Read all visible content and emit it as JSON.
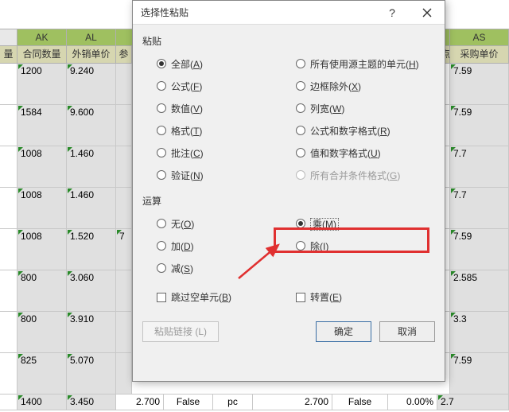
{
  "dialog": {
    "title": "选择性粘贴",
    "help": "?",
    "group_paste": "粘贴",
    "paste_left": [
      {
        "label": "全部",
        "key": "A",
        "on": true
      },
      {
        "label": "公式",
        "key": "F"
      },
      {
        "label": "数值",
        "key": "V"
      },
      {
        "label": "格式",
        "key": "T"
      },
      {
        "label": "批注",
        "key": "C"
      },
      {
        "label": "验证",
        "key": "N"
      }
    ],
    "paste_right": [
      {
        "label": "所有使用源主题的单元",
        "key": "H"
      },
      {
        "label": "边框除外",
        "key": "X"
      },
      {
        "label": "列宽",
        "key": "W"
      },
      {
        "label": "公式和数字格式",
        "key": "R"
      },
      {
        "label": "值和数字格式",
        "key": "U"
      },
      {
        "label": "所有合并条件格式",
        "key": "G",
        "disabled": true
      }
    ],
    "group_op": "运算",
    "op_left": [
      {
        "label": "无",
        "key": "O"
      },
      {
        "label": "加",
        "key": "D"
      },
      {
        "label": "减",
        "key": "S"
      }
    ],
    "op_right": [
      {
        "label": "乘",
        "key": "M",
        "on": true,
        "highlight": true
      },
      {
        "label": "除",
        "key": "I"
      }
    ],
    "skip_blanks": "跳过空单元",
    "skip_blanks_key": "B",
    "transpose": "转置",
    "transpose_key": "E",
    "paste_link": "粘贴链接 (L)",
    "ok": "确定",
    "cancel": "取消"
  },
  "sheet": {
    "cols": [
      "",
      "AK",
      "AL",
      "",
      "",
      "",
      "",
      "",
      "",
      "AS"
    ],
    "first_col_hdr": "量",
    "headers": [
      "合同数量",
      "外销单价",
      "参",
      "",
      "",
      "",
      "",
      "",
      "点",
      "采购单价"
    ],
    "rows": [
      {
        "a": "1200",
        "b": "9.240",
        "c": "",
        "z": "7.59"
      },
      {
        "a": "1584",
        "b": "9.600",
        "c": "",
        "z": "7.59"
      },
      {
        "a": "1008",
        "b": "1.460",
        "c": "",
        "z": "7.7"
      },
      {
        "a": "1008",
        "b": "1.460",
        "c": "",
        "z": "7.7"
      },
      {
        "a": "1008",
        "b": "1.520",
        "c": "7",
        "z": "7.59"
      },
      {
        "a": "800",
        "b": "3.060",
        "c": "",
        "z": "2.585"
      },
      {
        "a": "800",
        "b": "3.910",
        "c": "",
        "z": "3.3"
      },
      {
        "a": "825",
        "b": "5.070",
        "c": "",
        "z": "7.59"
      }
    ],
    "bottom": [
      "1400",
      "3.450",
      "2.700",
      "False",
      "pc",
      "2.700",
      "False",
      "0.00%",
      "2.7"
    ]
  },
  "chart_data": {
    "type": "table",
    "columns": [
      "合同数量",
      "外销单价",
      "采购单价"
    ],
    "rows": [
      [
        1200,
        9.24,
        7.59
      ],
      [
        1584,
        9.6,
        7.59
      ],
      [
        1008,
        1.46,
        7.7
      ],
      [
        1008,
        1.46,
        7.7
      ],
      [
        1008,
        1.52,
        7.59
      ],
      [
        800,
        3.06,
        2.585
      ],
      [
        800,
        3.91,
        3.3
      ],
      [
        825,
        5.07,
        7.59
      ],
      [
        1400,
        3.45,
        2.7
      ]
    ]
  }
}
